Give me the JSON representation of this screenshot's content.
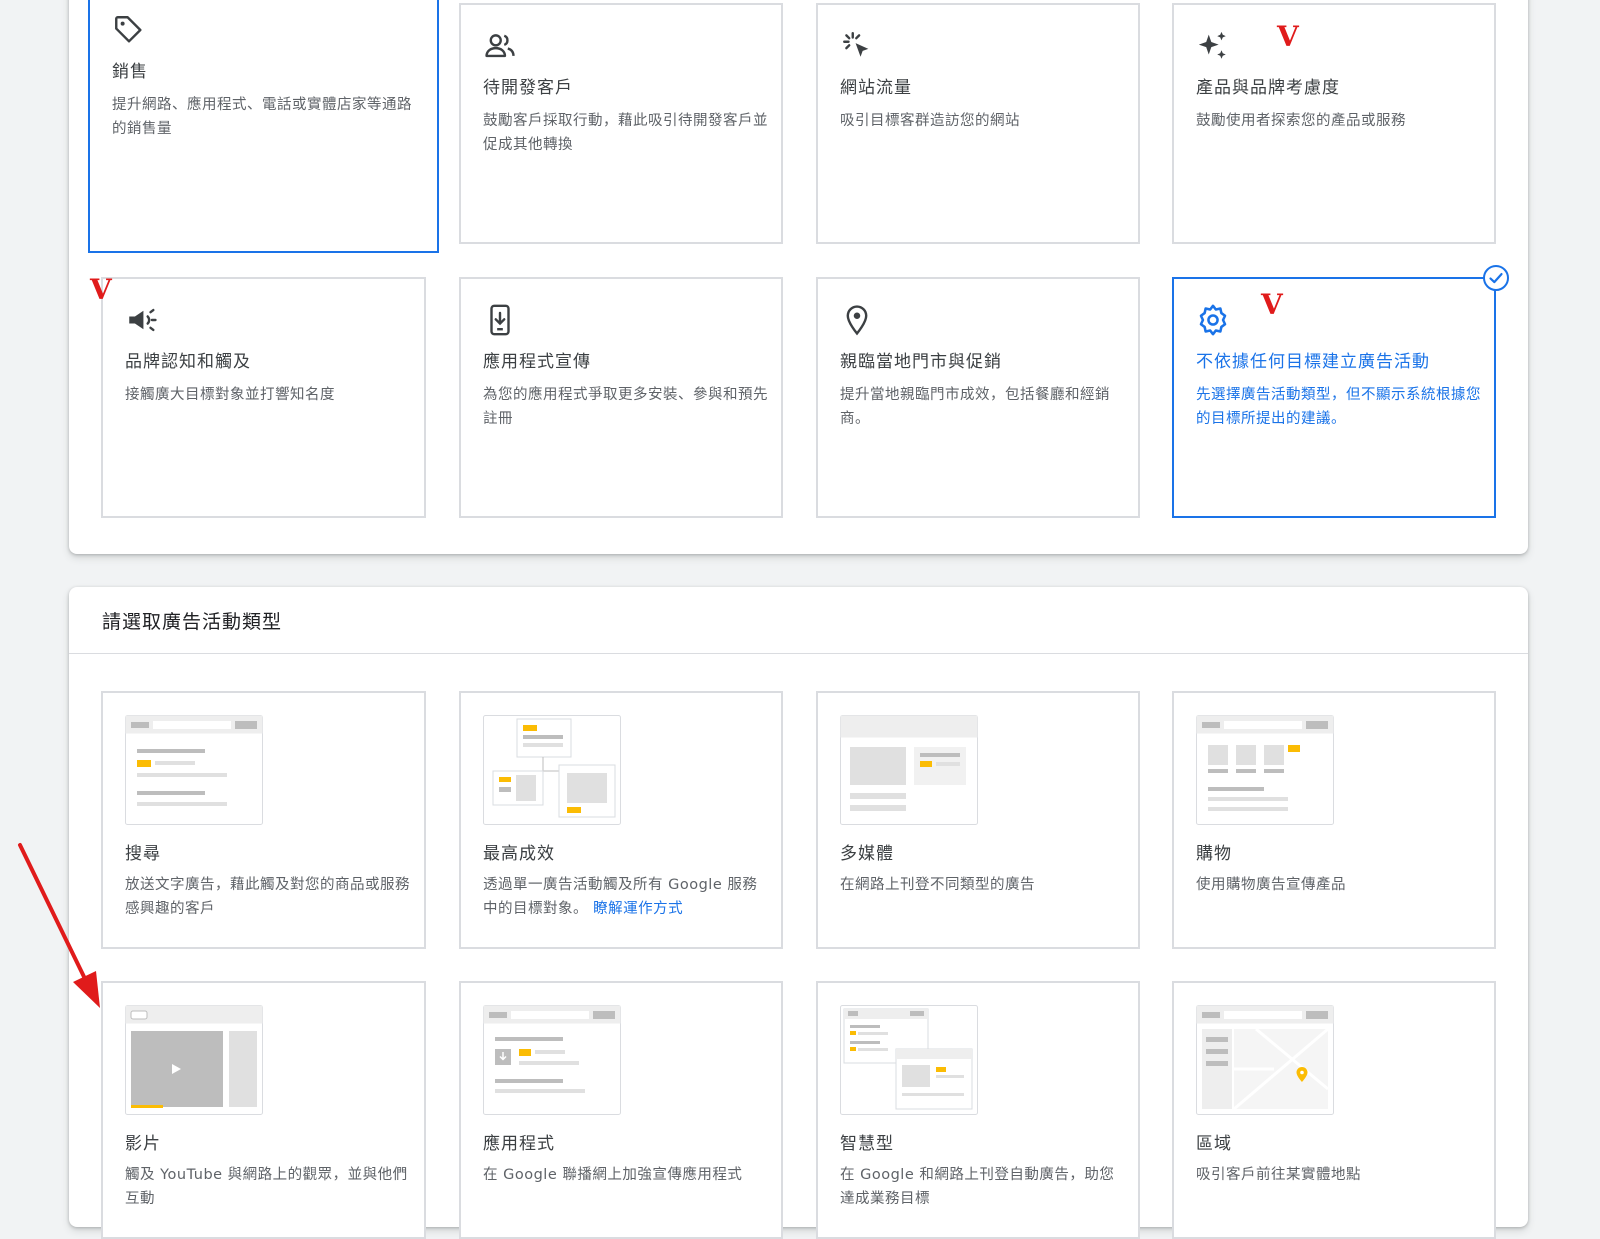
{
  "goals": [
    {
      "title": "銷售",
      "desc": "提升網路、應用程式、電話或實體店家等通路的銷售量"
    },
    {
      "title": "待開發客戶",
      "desc": "鼓勵客戶採取行動，藉此吸引待開發客戶並促成其他轉換"
    },
    {
      "title": "網站流量",
      "desc": "吸引目標客群造訪您的網站"
    },
    {
      "title": "產品與品牌考慮度",
      "desc": "鼓勵使用者探索您的產品或服務"
    },
    {
      "title": "品牌認知和觸及",
      "desc": "接觸廣大目標對象並打響知名度"
    },
    {
      "title": "應用程式宣傳",
      "desc": "為您的應用程式爭取更多安裝、參與和預先註冊"
    },
    {
      "title": "親臨當地門市與促銷",
      "desc": "提升當地親臨門市成效，包括餐廳和經銷商。"
    },
    {
      "title": "不依據任何目標建立廣告活動",
      "desc": "先選擇廣告活動類型，但不顯示系統根據您的目標所提出的建議。"
    }
  ],
  "types_section": {
    "title": "請選取廣告活動類型"
  },
  "types": [
    {
      "title": "搜尋",
      "desc": "放送文字廣告，藉此觸及對您的商品或服務感興趣的客戶"
    },
    {
      "title": "最高成效",
      "desc": "透過單一廣告活動觸及所有 Google 服務中的目標對象。",
      "link": "瞭解運作方式"
    },
    {
      "title": "多媒體",
      "desc": "在網路上刊登不同類型的廣告"
    },
    {
      "title": "購物",
      "desc": "使用購物廣告宣傳產品"
    },
    {
      "title": "影片",
      "desc": "觸及 YouTube 與網路上的觀眾，並與他們互動"
    },
    {
      "title": "應用程式",
      "desc": "在 Google 聯播網上加強宣傳應用程式"
    },
    {
      "title": "智慧型",
      "desc": "在 Google 和網路上刊登自動廣告，助您達成業務目標"
    },
    {
      "title": "區域",
      "desc": "吸引客戶前往某實體地點"
    }
  ],
  "annotations": {
    "mark": "V"
  },
  "colors": {
    "accent": "#1a73e8",
    "border": "#dadce0",
    "annotation": "#e01b1b",
    "thumb_highlight": "#fbbc04"
  }
}
